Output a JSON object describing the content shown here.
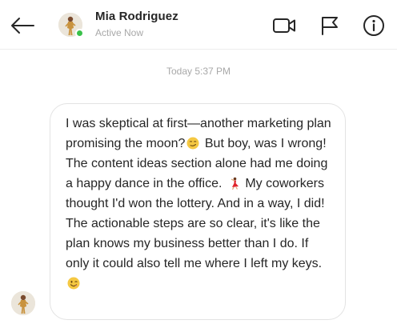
{
  "header": {
    "contact_name": "Mia Rodriguez",
    "status": "Active Now",
    "icons": [
      "back-arrow-icon",
      "video-camera-icon",
      "flag-icon",
      "info-icon"
    ],
    "online_color": "#3ac14a"
  },
  "thread": {
    "timestamp": "Today 5:37 PM",
    "message": {
      "seg1": "I was skeptical at first—another marketing plan promising the moon?",
      "seg2": "But boy, was I wrong! The content ideas section alone had me doing a happy dance in the office.",
      "seg3": "My coworkers thought I'd won the lottery. And in a way, I did! The actionable steps are so clear, it's like the plan knows my business better than I do. If only it could also tell me where I left my keys.",
      "emojis": [
        "smirking-face",
        "dancing-woman",
        "winking-face"
      ]
    }
  }
}
